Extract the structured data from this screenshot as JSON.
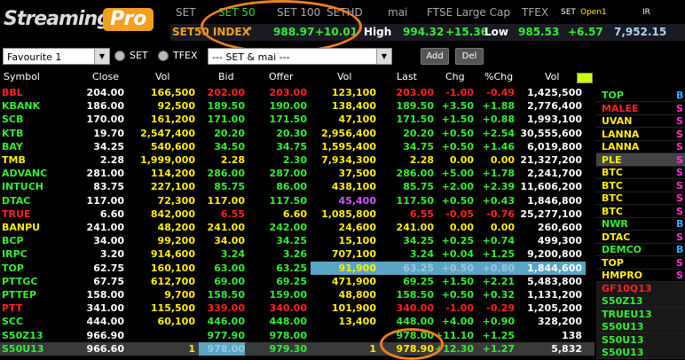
{
  "logo": {
    "stream": "Streaming",
    "pro": "Pro"
  },
  "tabs": [
    "SET",
    "SET 50",
    "SET 100",
    "SETHD",
    "mai",
    "FTSE Large Cap",
    "TFEX"
  ],
  "tab_status": {
    "label": "SET",
    "value": "Open1"
  },
  "tab_ir": "IR",
  "ticker": {
    "name": "SET50 INDEX",
    "value": "988.97",
    "change": "+10.01",
    "high_label": "High",
    "high": "994.32",
    "high_chg": "+15.36",
    "low_label": "Low",
    "low": "985.53",
    "low_chg": "+6.57",
    "vol": "7,952.15"
  },
  "controls": {
    "favourite": "Favourite 1",
    "radio_set": "SET",
    "radio_tfex": "TFEX",
    "market": "--- SET & mai ---",
    "add": "Add",
    "del": "Del"
  },
  "columns": [
    "Symbol",
    "Close",
    "Vol",
    "Bid",
    "Offer",
    "Vol",
    "Last",
    "Chg",
    "%Chg",
    "Vol"
  ],
  "rows": [
    [
      "BBL",
      "204.00",
      "166,500",
      "202.00",
      "203.00",
      "123,100",
      "203.00",
      "-1.00",
      "-0.49",
      "1,425,500"
    ],
    [
      "KBANK",
      "186.00",
      "92,500",
      "189.50",
      "190.00",
      "138,400",
      "189.50",
      "+3.50",
      "+1.88",
      "2,776,400"
    ],
    [
      "SCB",
      "170.00",
      "161,200",
      "171.00",
      "171.50",
      "47,100",
      "171.50",
      "+1.50",
      "+0.88",
      "1,993,100"
    ],
    [
      "KTB",
      "19.70",
      "2,547,400",
      "20.20",
      "20.30",
      "2,956,400",
      "20.20",
      "+0.50",
      "+2.54",
      "30,555,600"
    ],
    [
      "BAY",
      "34.25",
      "540,600",
      "34.50",
      "34.75",
      "1,595,400",
      "34.75",
      "+0.50",
      "+1.46",
      "6,019,800"
    ],
    [
      "TMB",
      "2.28",
      "1,999,000",
      "2.28",
      "2.30",
      "7,934,300",
      "2.28",
      "0.00",
      "0.00",
      "21,327,200"
    ],
    [
      "ADVANC",
      "281.00",
      "114,200",
      "286.00",
      "287.00",
      "37,500",
      "286.00",
      "+5.00",
      "+1.78",
      "2,241,700"
    ],
    [
      "INTUCH",
      "83.75",
      "227,100",
      "85.75",
      "86.00",
      "438,100",
      "85.75",
      "+2.00",
      "+2.39",
      "11,606,200"
    ],
    [
      "DTAC",
      "117.00",
      "72,300",
      "117.00",
      "117.50",
      "45,400",
      "117.50",
      "+0.50",
      "+0.43",
      "1,846,800"
    ],
    [
      "TRUE",
      "6.60",
      "842,000",
      "6.55",
      "6.60",
      "1,085,800",
      "6.55",
      "-0.05",
      "-0.76",
      "25,277,100"
    ],
    [
      "BANPU",
      "241.00",
      "48,200",
      "241.00",
      "242.00",
      "24,600",
      "241.00",
      "0.00",
      "0.00",
      "260,600"
    ],
    [
      "BCP",
      "34.00",
      "99,200",
      "34.00",
      "34.25",
      "15,100",
      "34.25",
      "+0.25",
      "+0.74",
      "499,300"
    ],
    [
      "IRPC",
      "3.20",
      "914,600",
      "3.24",
      "3.26",
      "707,100",
      "3.24",
      "+0.04",
      "+1.25",
      "9,200,800"
    ],
    [
      "TOP",
      "62.75",
      "160,100",
      "63.00",
      "63.25",
      "91,900",
      "63.25",
      "+0.50",
      "+0.80",
      "1,844,600"
    ],
    [
      "PTTGC",
      "67.75",
      "612,700",
      "69.00",
      "69.25",
      "471,900",
      "69.25",
      "+1.50",
      "+2.21",
      "5,483,800"
    ],
    [
      "PTTEP",
      "158.00",
      "9,700",
      "158.50",
      "159.00",
      "48,800",
      "158.50",
      "+0.50",
      "+0.32",
      "1,131,200"
    ],
    [
      "PTT",
      "341.00",
      "115,500",
      "339.00",
      "340.00",
      "101,900",
      "340.00",
      "-1.00",
      "-0.29",
      "1,205,200"
    ],
    [
      "SCC",
      "444.00",
      "60,100",
      "446.00",
      "448.00",
      "13,400",
      "448.00",
      "+4.00",
      "+0.90",
      "328,200"
    ],
    [
      "S50Z13",
      "966.90",
      "",
      "977.90",
      "978.00",
      "",
      "978.00",
      "+11.10",
      "+1.25",
      "138"
    ],
    [
      "S50U13",
      "966.60",
      "1",
      "978.00",
      "979.30",
      "1",
      "978.90",
      "+12.30",
      "+1.27",
      "5,832"
    ]
  ],
  "right_panel": [
    {
      "sym": "TOP",
      "side": "B"
    },
    {
      "sym": "MALEE",
      "side": "S"
    },
    {
      "sym": "UVAN",
      "side": "S"
    },
    {
      "sym": "LANNA",
      "side": "S"
    },
    {
      "sym": "LANNA",
      "side": "S"
    },
    {
      "sym": "PLE",
      "side": "S"
    },
    {
      "sym": "BTC",
      "side": "S"
    },
    {
      "sym": "BTC",
      "side": "S"
    },
    {
      "sym": "BTC",
      "side": "S"
    },
    {
      "sym": "BTC",
      "side": "S"
    },
    {
      "sym": "NWR",
      "side": "B"
    },
    {
      "sym": "DTAC",
      "side": "S"
    },
    {
      "sym": "DEMCO",
      "side": "B"
    },
    {
      "sym": "TOP",
      "side": "S"
    },
    {
      "sym": "HMPRO",
      "side": "S"
    },
    {
      "sym": "GF10Q13",
      "side": ""
    },
    {
      "sym": "S50Z13",
      "side": ""
    },
    {
      "sym": "TRUEU13",
      "side": ""
    },
    {
      "sym": "S50U13",
      "side": ""
    },
    {
      "sym": "S50U13",
      "side": ""
    },
    {
      "sym": "S50U13",
      "side": ""
    }
  ],
  "colors": {
    "up": "#33ee33",
    "down": "#ff2222",
    "flat": "#ffee00",
    "purple": "#cc55ff",
    "hl": "#5aa5c4"
  }
}
